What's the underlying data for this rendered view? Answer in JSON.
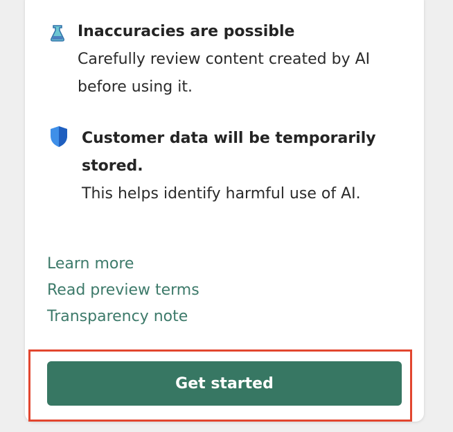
{
  "notices": [
    {
      "icon": "beaker-icon",
      "title": "Inaccuracies are possible",
      "body": "Carefully review content created by AI before using it."
    },
    {
      "icon": "shield-icon",
      "title": "Customer data will be temporarily stored.",
      "body": "This helps identify harmful use of AI."
    }
  ],
  "links": {
    "learn_more": "Learn more",
    "preview_terms": "Read preview terms",
    "transparency": "Transparency note"
  },
  "button": {
    "label": "Get started"
  },
  "colors": {
    "link": "#3d7a6a",
    "button_bg": "#377763",
    "highlight": "#e2462f"
  }
}
